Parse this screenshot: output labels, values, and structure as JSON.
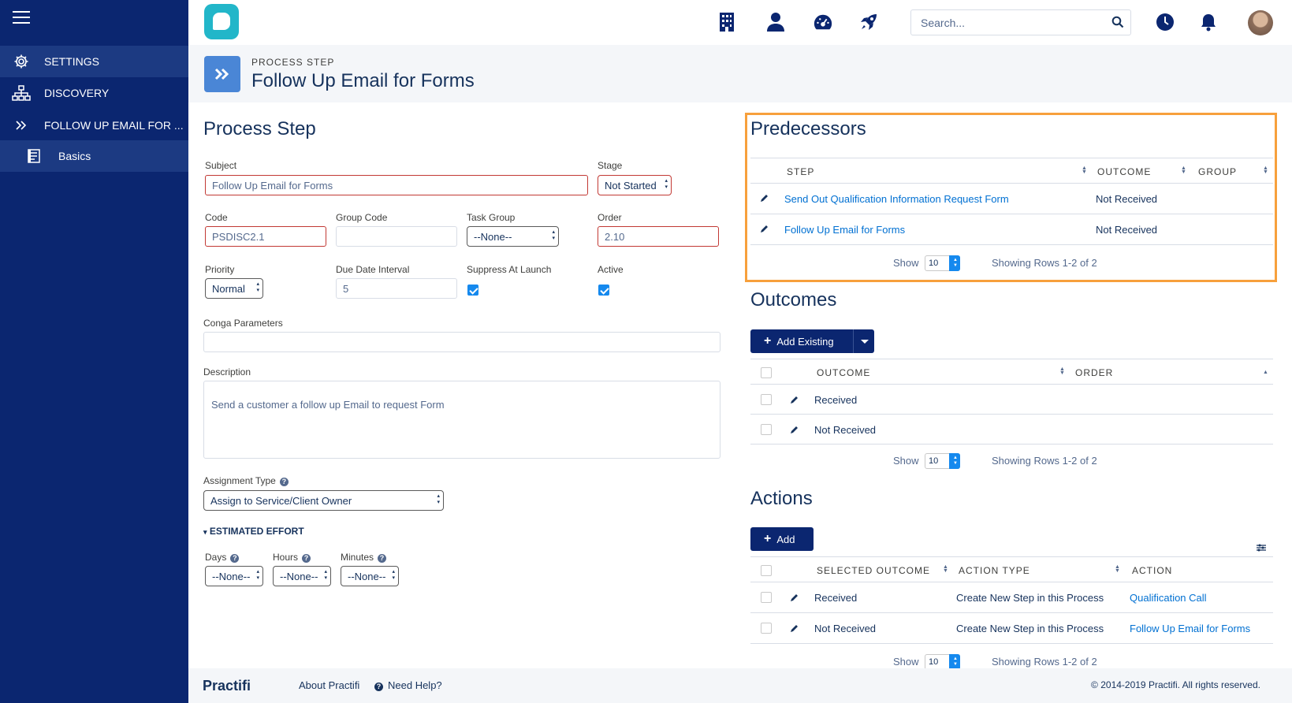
{
  "sidebar": {
    "items": [
      {
        "label": "SETTINGS",
        "icon": "gear-icon"
      },
      {
        "label": "DISCOVERY",
        "icon": "org-chart-icon"
      },
      {
        "label": "FOLLOW UP EMAIL FOR ...",
        "icon": "double-chevron-right-icon"
      },
      {
        "label": "Basics",
        "icon": "document-icon"
      }
    ]
  },
  "topbar": {
    "search_placeholder": "Search..."
  },
  "header": {
    "eyebrow": "PROCESS STEP",
    "title": "Follow Up Email for Forms"
  },
  "form": {
    "title": "Process Step",
    "subject_label": "Subject",
    "subject_value": "Follow Up Email for Forms",
    "stage_label": "Stage",
    "stage_value": "Not Started",
    "code_label": "Code",
    "code_value": "PSDISC2.1",
    "group_code_label": "Group Code",
    "group_code_value": "",
    "task_group_label": "Task Group",
    "task_group_value": "--None--",
    "order_label": "Order",
    "order_value": "2.10",
    "priority_label": "Priority",
    "priority_value": "Normal",
    "due_label": "Due Date Interval",
    "due_value": "5",
    "suppress_label": "Suppress At Launch",
    "suppress_checked": true,
    "active_label": "Active",
    "active_checked": true,
    "conga_label": "Conga Parameters",
    "conga_value": "",
    "description_label": "Description",
    "description_value": "Send a customer a follow up Email to request Form",
    "assignment_label": "Assignment Type",
    "assignment_value": "Assign to Service/Client Owner",
    "effort_label": "ESTIMATED EFFORT",
    "days_label": "Days",
    "hours_label": "Hours",
    "minutes_label": "Minutes",
    "days_value": "--None--",
    "hours_value": "--None--",
    "minutes_value": "--None--"
  },
  "predecessors": {
    "title": "Predecessors",
    "columns": [
      "STEP",
      "OUTCOME",
      "GROUP"
    ],
    "rows": [
      {
        "step": "Send Out Qualification Information Request Form",
        "outcome": "Not Received"
      },
      {
        "step": "Follow Up Email for Forms",
        "outcome": "Not Received"
      }
    ],
    "show_label": "Show",
    "page_size": "10",
    "showing": "Showing Rows 1-2 of 2"
  },
  "outcomes": {
    "title": "Outcomes",
    "add_existing": "Add Existing",
    "columns": [
      "OUTCOME",
      "ORDER"
    ],
    "rows": [
      {
        "outcome": "Received"
      },
      {
        "outcome": "Not Received"
      }
    ],
    "show_label": "Show",
    "page_size": "10",
    "showing": "Showing Rows 1-2 of 2"
  },
  "actions": {
    "title": "Actions",
    "add": "Add",
    "columns": [
      "SELECTED OUTCOME",
      "ACTION TYPE",
      "ACTION"
    ],
    "rows": [
      {
        "outcome": "Received",
        "type": "Create New Step in this Process",
        "action": "Qualification Call"
      },
      {
        "outcome": "Not Received",
        "type": "Create New Step in this Process",
        "action": "Follow Up Email for Forms"
      }
    ],
    "show_label": "Show",
    "page_size": "10",
    "showing": "Showing Rows 1-2 of 2"
  },
  "footer": {
    "logo": "Practifi",
    "about": "About Practifi",
    "help": "Need Help?",
    "copyright": "© 2014-2019 Practifi. All rights reserved."
  },
  "colors": {
    "sidebar": "#0b2670",
    "accent": "#0070d2",
    "highlight": "#f7a03c",
    "logo": "#22b6c9"
  }
}
